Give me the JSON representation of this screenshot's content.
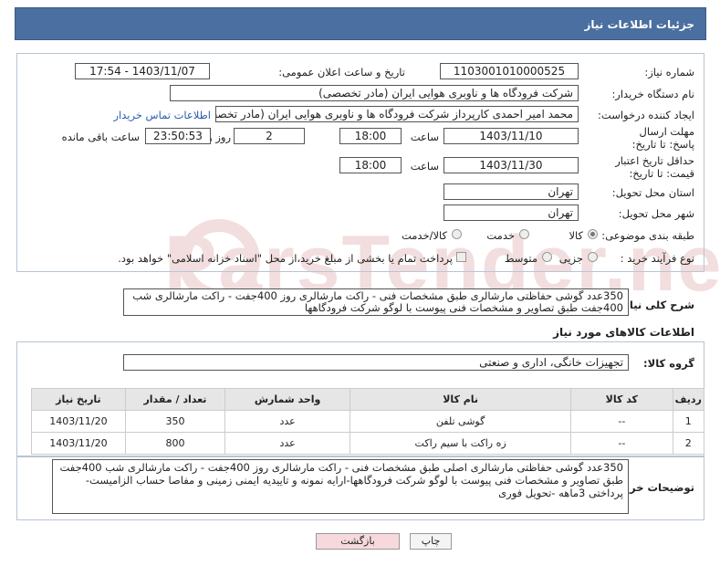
{
  "header": {
    "title": "جزئیات اطلاعات نیاز"
  },
  "form": {
    "need_number_label": "شماره نیاز:",
    "need_number": "1103001010000525",
    "announce_label": "تاریخ و ساعت اعلان عمومی:",
    "announce_value": "1403/11/07 - 17:54",
    "buyer_label": "نام دستگاه خریدار:",
    "buyer_value": "شرکت فرودگاه ها و ناوبری هوایی ایران (مادر تخصصی)",
    "requester_label": "ایجاد کننده درخواست:",
    "requester_value": "محمد امیر احمدی کارپرداز شرکت فرودگاه ها و ناوبری هوایی ایران (مادر تخصصی)",
    "contact_link": "اطلاعات تماس خریدار",
    "deadline_label": "مهلت ارسال پاسخ: تا تاریخ:",
    "deadline_date": "1403/11/10",
    "time_label": "ساعت",
    "deadline_time": "18:00",
    "days_value": "2",
    "days_label": "روز و",
    "remaining_time": "23:50:53",
    "remaining_label": "ساعت باقی مانده",
    "validity_label": "حداقل تاریخ اعتبار قیمت: تا تاریخ:",
    "validity_date": "1403/11/30",
    "validity_time": "18:00",
    "province_label": "استان محل تحویل:",
    "province_value": "تهران",
    "city_label": "شهر محل تحویل:",
    "city_value": "تهران",
    "category_label": "طبقه بندی موضوعی:",
    "category_options": [
      "کالا",
      "خدمت",
      "کالا/خدمت"
    ],
    "process_label": "نوع فرآیند خرید :",
    "process_options": [
      "جزیی",
      "متوسط"
    ],
    "payment_note": "پرداخت تمام یا بخشی از مبلغ خرید،از محل \"اسناد خزانه اسلامی\" خواهد بود."
  },
  "summary": {
    "label": "شرح کلی نیاز:",
    "text": "350عدد گوشی حفاظتی مارشالری طبق مشخصات فنی - راکت مارشالری روز 400جفت - راکت مارشالری شب 400جفت طبق تصاویر و مشخصات فنی پیوست با لوگو شرکت فرودگاهها"
  },
  "goods": {
    "section_title": "اطلاعات کالاهای مورد نیاز",
    "group_label": "گروه کالا:",
    "group_value": "تجهیزات خانگی، اداری و صنعتی",
    "columns": [
      "ردیف",
      "کد کالا",
      "نام کالا",
      "واحد شمارش",
      "تعداد / مقدار",
      "تاریخ نیاز"
    ],
    "rows": [
      [
        "1",
        "--",
        "گوشی تلفن",
        "عدد",
        "350",
        "1403/11/20"
      ],
      [
        "2",
        "--",
        "زه راکت با سیم راکت",
        "عدد",
        "800",
        "1403/11/20"
      ]
    ]
  },
  "buyer_notes": {
    "label": "توضیحات خریدار:",
    "text": "350عدد گوشی حفاظتی مارشالری اصلی طبق مشخصات فنی - راکت مارشالری روز 400جفت - راکت مارشالری شب 400جفت طبق تصاویر و مشخصات فنی پیوست با لوگو شرکت فرودگاهها-ارایه نمونه و تاییدیه ایمنی زمینی و مفاصا حساب الزامیست-پرداختی 3ماهه -تحویل فوری"
  },
  "buttons": {
    "print": "چاپ",
    "back": "بازگشت"
  },
  "watermark": "ParsTender.net",
  "colors": {
    "header_bg": "#4a6fa0",
    "back_button_bg": "#f7d9dd",
    "link": "#2a5db0"
  }
}
